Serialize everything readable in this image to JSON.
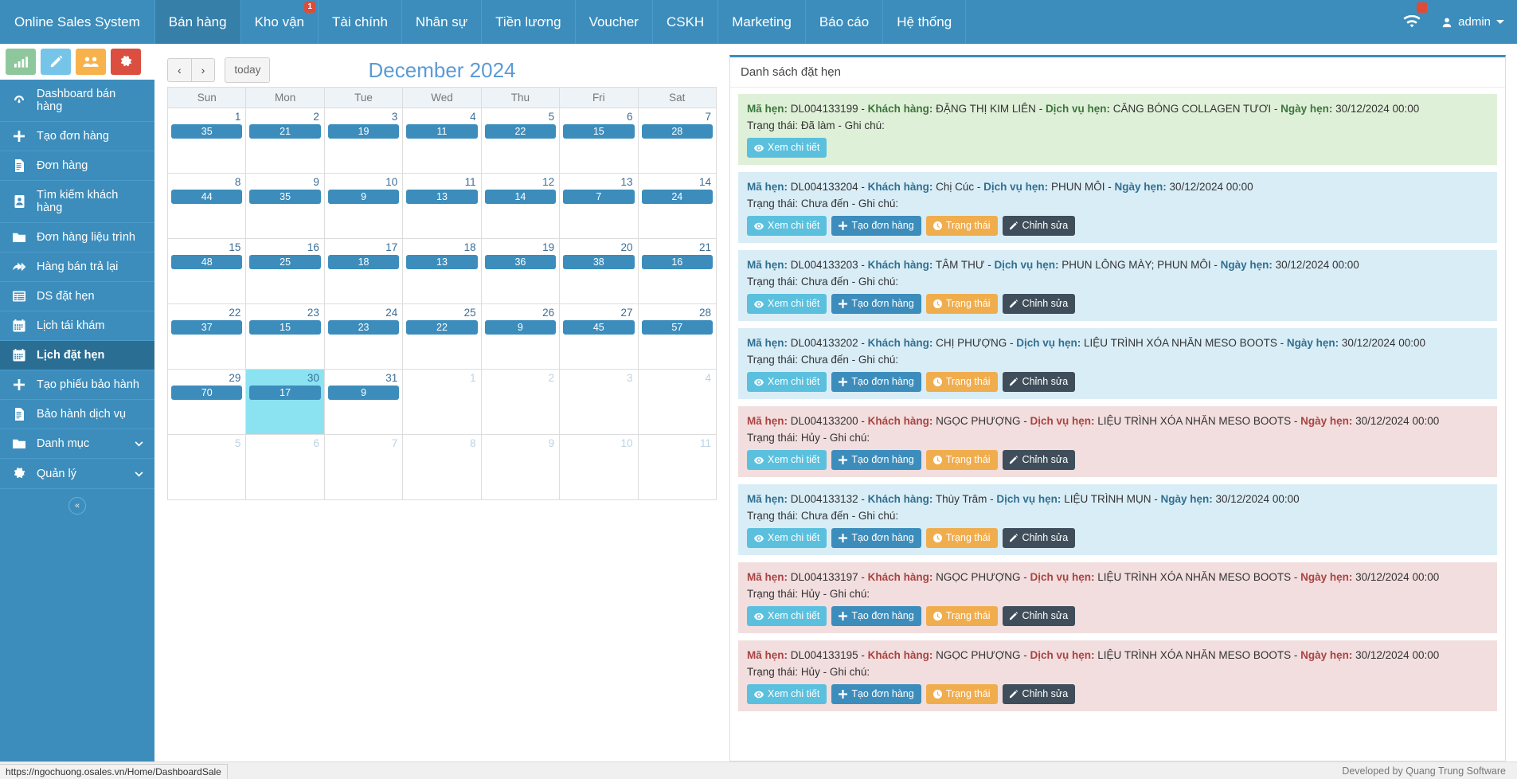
{
  "topnav": {
    "brand": "Online Sales System",
    "items": [
      {
        "label": "Bán hàng",
        "active": true,
        "badge": null
      },
      {
        "label": "Kho vận",
        "active": false,
        "badge": "1"
      },
      {
        "label": "Tài chính",
        "active": false,
        "badge": null
      },
      {
        "label": "Nhân sự",
        "active": false,
        "badge": null
      },
      {
        "label": "Tiền lương",
        "active": false,
        "badge": null
      },
      {
        "label": "Voucher",
        "active": false,
        "badge": null
      },
      {
        "label": "CSKH",
        "active": false,
        "badge": null
      },
      {
        "label": "Marketing",
        "active": false,
        "badge": null
      },
      {
        "label": "Báo cáo",
        "active": false,
        "badge": null
      },
      {
        "label": "Hệ thống",
        "active": false,
        "badge": null
      }
    ],
    "user": "admin",
    "wifi_icon": "wifi-icon"
  },
  "sidebar": {
    "quick_buttons": [
      {
        "name": "chart-icon",
        "color": "#8fc79c"
      },
      {
        "name": "pencil-icon",
        "color": "#76c5e8"
      },
      {
        "name": "users-icon",
        "color": "#f7b24c"
      },
      {
        "name": "gear-icon",
        "color": "#da4f3f"
      }
    ],
    "items": [
      {
        "label": "Dashboard bán hàng",
        "icon": "dashboard-icon",
        "active": false,
        "chevron": false
      },
      {
        "label": "Tạo đơn hàng",
        "icon": "plus-icon",
        "active": false,
        "chevron": false
      },
      {
        "label": "Đơn hàng",
        "icon": "document-icon",
        "active": false,
        "chevron": false
      },
      {
        "label": "Tìm kiếm khách hàng",
        "icon": "contact-card-icon",
        "active": false,
        "chevron": false
      },
      {
        "label": "Đơn hàng liệu trình",
        "icon": "folder-icon",
        "active": false,
        "chevron": false
      },
      {
        "label": "Hàng bán trả lại",
        "icon": "reply-all-icon",
        "active": false,
        "chevron": false
      },
      {
        "label": "DS đặt hẹn",
        "icon": "list-icon",
        "active": false,
        "chevron": false
      },
      {
        "label": "Lịch tái khám",
        "icon": "calendar-icon",
        "active": false,
        "chevron": false
      },
      {
        "label": "Lịch đặt hẹn",
        "icon": "calendar-icon",
        "active": true,
        "chevron": false
      },
      {
        "label": "Tạo phiếu bảo hành",
        "icon": "plus-icon",
        "active": false,
        "chevron": false
      },
      {
        "label": "Bảo hành dịch vụ",
        "icon": "document-icon",
        "active": false,
        "chevron": false
      },
      {
        "label": "Danh mục",
        "icon": "folder-icon",
        "active": false,
        "chevron": true
      },
      {
        "label": "Quản lý",
        "icon": "gear-icon",
        "active": false,
        "chevron": true
      }
    ],
    "collapse_label": "«"
  },
  "calendar": {
    "prev_label": "‹",
    "next_label": "›",
    "today_label": "today",
    "title": "December 2024",
    "weekdays": [
      "Sun",
      "Mon",
      "Tue",
      "Wed",
      "Thu",
      "Fri",
      "Sat"
    ],
    "weeks": [
      [
        {
          "day": "1",
          "count": "35",
          "other": false,
          "today": false
        },
        {
          "day": "2",
          "count": "21",
          "other": false,
          "today": false
        },
        {
          "day": "3",
          "count": "19",
          "other": false,
          "today": false
        },
        {
          "day": "4",
          "count": "11",
          "other": false,
          "today": false
        },
        {
          "day": "5",
          "count": "22",
          "other": false,
          "today": false
        },
        {
          "day": "6",
          "count": "15",
          "other": false,
          "today": false
        },
        {
          "day": "7",
          "count": "28",
          "other": false,
          "today": false
        }
      ],
      [
        {
          "day": "8",
          "count": "44",
          "other": false,
          "today": false
        },
        {
          "day": "9",
          "count": "35",
          "other": false,
          "today": false
        },
        {
          "day": "10",
          "count": "9",
          "other": false,
          "today": false
        },
        {
          "day": "11",
          "count": "13",
          "other": false,
          "today": false
        },
        {
          "day": "12",
          "count": "14",
          "other": false,
          "today": false
        },
        {
          "day": "13",
          "count": "7",
          "other": false,
          "today": false
        },
        {
          "day": "14",
          "count": "24",
          "other": false,
          "today": false
        }
      ],
      [
        {
          "day": "15",
          "count": "48",
          "other": false,
          "today": false
        },
        {
          "day": "16",
          "count": "25",
          "other": false,
          "today": false
        },
        {
          "day": "17",
          "count": "18",
          "other": false,
          "today": false
        },
        {
          "day": "18",
          "count": "13",
          "other": false,
          "today": false
        },
        {
          "day": "19",
          "count": "36",
          "other": false,
          "today": false
        },
        {
          "day": "20",
          "count": "38",
          "other": false,
          "today": false
        },
        {
          "day": "21",
          "count": "16",
          "other": false,
          "today": false
        }
      ],
      [
        {
          "day": "22",
          "count": "37",
          "other": false,
          "today": false
        },
        {
          "day": "23",
          "count": "15",
          "other": false,
          "today": false
        },
        {
          "day": "24",
          "count": "23",
          "other": false,
          "today": false
        },
        {
          "day": "25",
          "count": "22",
          "other": false,
          "today": false
        },
        {
          "day": "26",
          "count": "9",
          "other": false,
          "today": false
        },
        {
          "day": "27",
          "count": "45",
          "other": false,
          "today": false
        },
        {
          "day": "28",
          "count": "57",
          "other": false,
          "today": false
        }
      ],
      [
        {
          "day": "29",
          "count": "70",
          "other": false,
          "today": false
        },
        {
          "day": "30",
          "count": "17",
          "other": false,
          "today": true
        },
        {
          "day": "31",
          "count": "9",
          "other": false,
          "today": false
        },
        {
          "day": "1",
          "count": null,
          "other": true,
          "today": false
        },
        {
          "day": "2",
          "count": null,
          "other": true,
          "today": false
        },
        {
          "day": "3",
          "count": null,
          "other": true,
          "today": false
        },
        {
          "day": "4",
          "count": null,
          "other": true,
          "today": false
        }
      ],
      [
        {
          "day": "5",
          "count": null,
          "other": true,
          "today": false
        },
        {
          "day": "6",
          "count": null,
          "other": true,
          "today": false
        },
        {
          "day": "7",
          "count": null,
          "other": true,
          "today": false
        },
        {
          "day": "8",
          "count": null,
          "other": true,
          "today": false
        },
        {
          "day": "9",
          "count": null,
          "other": true,
          "today": false
        },
        {
          "day": "10",
          "count": null,
          "other": true,
          "today": false
        },
        {
          "day": "11",
          "count": null,
          "other": true,
          "today": false
        }
      ]
    ]
  },
  "panel": {
    "title": "Danh sách đặt hẹn",
    "labels": {
      "code": "Mã hẹn:",
      "customer": "Khách hàng:",
      "service": "Dịch vụ hẹn:",
      "date": "Ngày hẹn:",
      "status_prefix": "Trạng thái:",
      "note_prefix": "Ghi chú:"
    },
    "buttons": {
      "detail": "Xem chi tiết",
      "create_order": "Tạo đơn hàng",
      "status": "Trạng thái",
      "edit": "Chỉnh sửa"
    },
    "appointments": [
      {
        "color": "green",
        "code": "DL004133199",
        "customer": "ĐẶNG THỊ KIM LIÊN",
        "service": "CĂNG BÓNG COLLAGEN TƯƠI",
        "date": "30/12/2024 00:00",
        "status": "Đã làm",
        "note": "",
        "actions": [
          "detail"
        ]
      },
      {
        "color": "blue",
        "code": "DL004133204",
        "customer": "Chị Cúc",
        "service": "PHUN MÔI",
        "date": "30/12/2024 00:00",
        "status": "Chưa đến",
        "note": "",
        "actions": [
          "detail",
          "create_order",
          "status",
          "edit"
        ]
      },
      {
        "color": "blue",
        "code": "DL004133203",
        "customer": "TÂM THƯ",
        "service": "PHUN LÔNG MÀY; PHUN MÔI",
        "date": "30/12/2024 00:00",
        "status": "Chưa đến",
        "note": "",
        "actions": [
          "detail",
          "create_order",
          "status",
          "edit"
        ]
      },
      {
        "color": "blue",
        "code": "DL004133202",
        "customer": "CHỊ PHƯỢNG",
        "service": "LIỆU TRÌNH XÓA NHĂN MESO BOOTS",
        "date": "30/12/2024 00:00",
        "status": "Chưa đến",
        "note": "",
        "actions": [
          "detail",
          "create_order",
          "status",
          "edit"
        ]
      },
      {
        "color": "red",
        "code": "DL004133200",
        "customer": "NGỌC PHƯỢNG",
        "service": "LIỆU TRÌNH XÓA NHĂN MESO BOOTS",
        "date": "30/12/2024 00:00",
        "status": "Hủy",
        "note": "",
        "actions": [
          "detail",
          "create_order",
          "status",
          "edit"
        ]
      },
      {
        "color": "blue",
        "code": "DL004133132",
        "customer": "Thùy Trâm",
        "service": "LIỆU TRÌNH MỤN",
        "date": "30/12/2024 00:00",
        "status": "Chưa đến",
        "note": "",
        "actions": [
          "detail",
          "create_order",
          "status",
          "edit"
        ]
      },
      {
        "color": "red",
        "code": "DL004133197",
        "customer": "NGỌC PHƯỢNG",
        "service": "LIỆU TRÌNH XÓA NHĂN MESO BOOTS",
        "date": "30/12/2024 00:00",
        "status": "Hủy",
        "note": "",
        "actions": [
          "detail",
          "create_order",
          "status",
          "edit"
        ]
      },
      {
        "color": "red",
        "code": "DL004133195",
        "customer": "NGỌC PHƯỢNG",
        "service": "LIỆU TRÌNH XÓA NHĂN MESO BOOTS",
        "date": "30/12/2024 00:00",
        "status": "Hủy",
        "note": "",
        "actions": [
          "detail",
          "create_order",
          "status",
          "edit"
        ]
      }
    ]
  },
  "footer": {
    "status_url": "https://ngochuong.osales.vn/Home/DashboardSale",
    "credit": "Developed by Quang Trung Software"
  },
  "colors": {
    "brand": "#3c8dbc",
    "brand_dark": "#367fa9",
    "accent_today": "#8be3f2",
    "badge_red": "#dd4b39",
    "event_blue": "#3c8dbc",
    "green_row": "#dff0d8",
    "blue_row": "#d9edf7",
    "red_row": "#f2dede"
  }
}
